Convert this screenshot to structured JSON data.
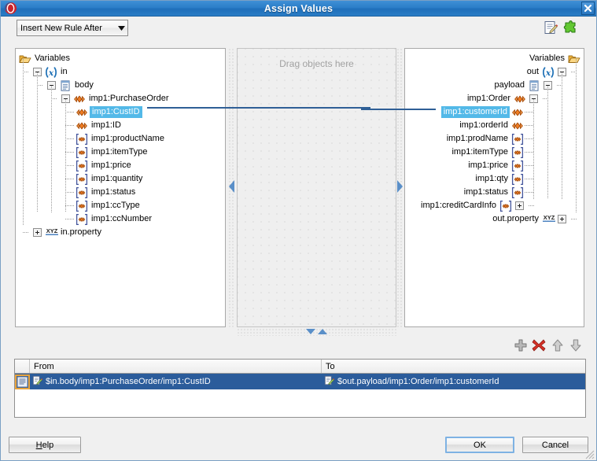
{
  "window": {
    "title": "Assign Values",
    "app_icon": "oracle-logo-icon",
    "close_icon": "close-icon"
  },
  "toolbar": {
    "rule_mode": "Insert New Rule After",
    "edit_icon": "edit-document-icon",
    "plugin_icon": "puzzle-piece-icon"
  },
  "source_tree": {
    "header": "Variables",
    "nodes": [
      {
        "label": "Variables",
        "icon": "folder-icon",
        "indent": 0,
        "expander": "",
        "selected": false
      },
      {
        "label": "in",
        "icon": "variable-icon",
        "indent": 1,
        "expander": "minus",
        "selected": false
      },
      {
        "label": "body",
        "icon": "document-icon",
        "indent": 2,
        "expander": "minus",
        "selected": false
      },
      {
        "label": "imp1:PurchaseOrder",
        "icon": "element-icon",
        "indent": 3,
        "expander": "minus",
        "selected": false
      },
      {
        "label": "imp1:CustID",
        "icon": "element-icon",
        "indent": 4,
        "expander": "",
        "selected": true
      },
      {
        "label": "imp1:ID",
        "icon": "element-icon",
        "indent": 4,
        "expander": "",
        "selected": false
      },
      {
        "label": "imp1:productName",
        "icon": "attribute-icon",
        "indent": 4,
        "expander": "",
        "selected": false
      },
      {
        "label": "imp1:itemType",
        "icon": "attribute-icon",
        "indent": 4,
        "expander": "",
        "selected": false
      },
      {
        "label": "imp1:price",
        "icon": "attribute-icon",
        "indent": 4,
        "expander": "",
        "selected": false
      },
      {
        "label": "imp1:quantity",
        "icon": "attribute-icon",
        "indent": 4,
        "expander": "",
        "selected": false
      },
      {
        "label": "imp1:status",
        "icon": "attribute-icon",
        "indent": 4,
        "expander": "",
        "selected": false
      },
      {
        "label": "imp1:ccType",
        "icon": "attribute-icon",
        "indent": 4,
        "expander": "",
        "selected": false
      },
      {
        "label": "imp1:ccNumber",
        "icon": "attribute-icon",
        "indent": 4,
        "expander": "",
        "selected": false
      },
      {
        "label": "in.property",
        "icon": "xyz-icon",
        "indent": 1,
        "expander": "plus",
        "selected": false
      }
    ]
  },
  "canvas": {
    "hint": "Drag objects here"
  },
  "target_tree": {
    "header": "Variables",
    "nodes": [
      {
        "label": "Variables",
        "icon": "folder-icon",
        "indent": 0,
        "expander": "",
        "selected": false
      },
      {
        "label": "out",
        "icon": "variable-icon",
        "indent": 1,
        "expander": "minus",
        "selected": false
      },
      {
        "label": "payload",
        "icon": "document-icon",
        "indent": 2,
        "expander": "minus",
        "selected": false
      },
      {
        "label": "imp1:Order",
        "icon": "element-icon",
        "indent": 3,
        "expander": "minus",
        "selected": false
      },
      {
        "label": "imp1:customerId",
        "icon": "element-icon",
        "indent": 4,
        "expander": "",
        "selected": true
      },
      {
        "label": "imp1:orderId",
        "icon": "element-icon",
        "indent": 4,
        "expander": "",
        "selected": false
      },
      {
        "label": "imp1:prodName",
        "icon": "attribute-icon",
        "indent": 4,
        "expander": "",
        "selected": false
      },
      {
        "label": "imp1:itemType",
        "icon": "attribute-icon",
        "indent": 4,
        "expander": "",
        "selected": false
      },
      {
        "label": "imp1:price",
        "icon": "attribute-icon",
        "indent": 4,
        "expander": "",
        "selected": false
      },
      {
        "label": "imp1:qty",
        "icon": "attribute-icon",
        "indent": 4,
        "expander": "",
        "selected": false
      },
      {
        "label": "imp1:status",
        "icon": "attribute-icon",
        "indent": 4,
        "expander": "",
        "selected": false
      },
      {
        "label": "imp1:creditCardInfo",
        "icon": "attribute-icon",
        "indent": 4,
        "expander": "plus",
        "selected": false
      },
      {
        "label": "out.property",
        "icon": "xyz-icon",
        "indent": 1,
        "expander": "plus",
        "selected": false
      }
    ]
  },
  "mapping_toolbar": {
    "add_icon": "plus-icon",
    "delete_icon": "delete-x-icon",
    "move_up_icon": "arrow-up-icon",
    "move_down_icon": "arrow-down-icon"
  },
  "mapping_table": {
    "columns": [
      "",
      "From",
      "To"
    ],
    "rows": [
      {
        "row_icon": "row-selector-icon",
        "from_icon": "expression-edit-icon",
        "from": "$in.body/imp1:PurchaseOrder/imp1:CustID",
        "to_icon": "expression-edit-icon",
        "to": "$out.payload/imp1:Order/imp1:customerId",
        "selected": true
      }
    ]
  },
  "buttons": {
    "help": "Help",
    "help_mnemonic": "H",
    "ok": "OK",
    "cancel": "Cancel"
  },
  "colors": {
    "titlebar": "#2b7ec8",
    "selection_tree": "#53b9e8",
    "selection_row": "#2b5c9b",
    "link_line": "#2f5f96",
    "element_icon": "#e8732a",
    "folder_icon": "#e8b340"
  }
}
